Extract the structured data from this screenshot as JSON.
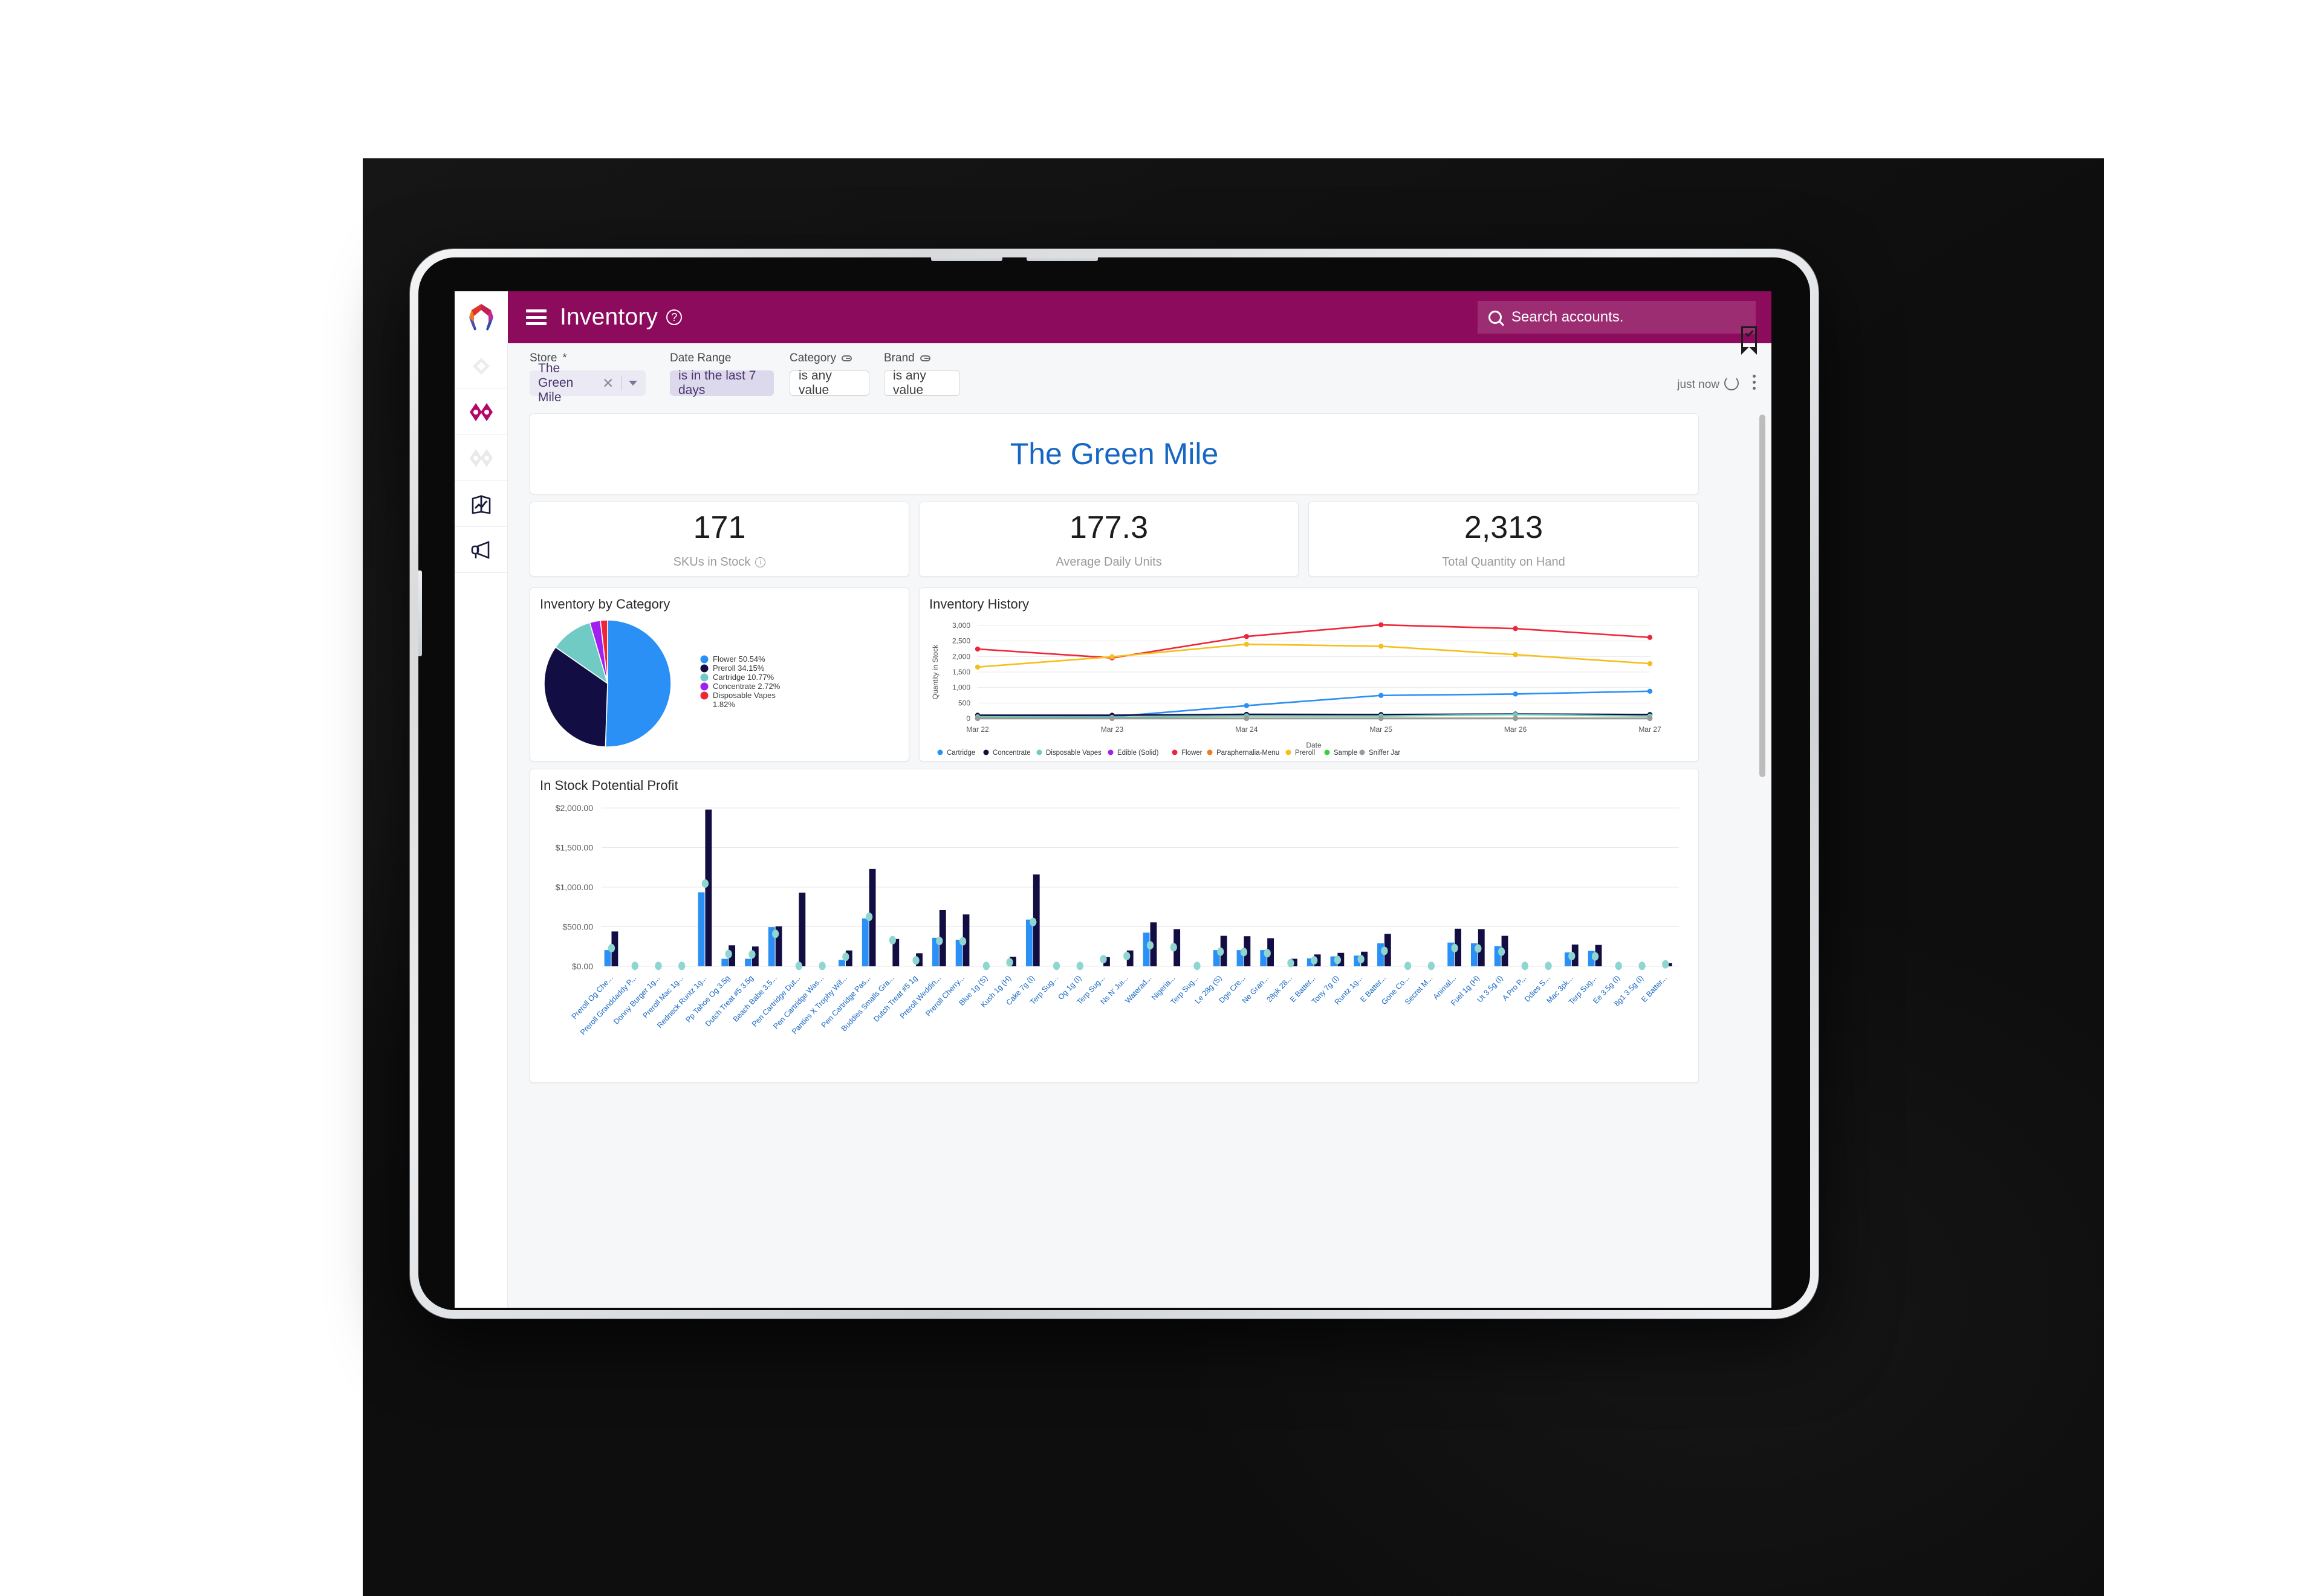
{
  "app": {
    "title": "Inventory",
    "help_icon": "question-mark-circle-icon",
    "menu_icon": "hamburger-menu-icon",
    "brand_color": "#8c0b5c"
  },
  "search": {
    "placeholder": "Search accounts.",
    "icon": "search-icon"
  },
  "sidebar": {
    "items": [
      {
        "name": "diamond-outline-icon",
        "active": false
      },
      {
        "name": "double-diamond-icon",
        "active": true
      },
      {
        "name": "double-diamond-light-icon",
        "active": false
      },
      {
        "name": "report-trend-icon",
        "active": false
      },
      {
        "name": "megaphone-icon",
        "active": false
      }
    ]
  },
  "filters": [
    {
      "label": "Store",
      "required": "*",
      "value": "The Green Mile",
      "style": "selected",
      "has_clear": true,
      "has_dropdown": true
    },
    {
      "label": "Date Range",
      "value": "is in the last 7 days",
      "style": "filled"
    },
    {
      "label": "Category",
      "value": "is any value",
      "style": "empty",
      "linked": true
    },
    {
      "label": "Brand",
      "value": "is any value",
      "style": "empty",
      "linked": true
    }
  ],
  "toolbar": {
    "updated_label": "just now",
    "refresh_icon": "refresh-icon",
    "more_icon": "kebab-menu-icon",
    "bookmark_icon": "bookmark-check-icon"
  },
  "dashboard": {
    "store_title": "The Green Mile",
    "kpis": [
      {
        "value": "171",
        "label": "SKUs in Stock",
        "has_info": true
      },
      {
        "value": "177.3",
        "label": "Average Daily Units",
        "has_info": false
      },
      {
        "value": "2,313",
        "label": "Total Quantity on Hand",
        "has_info": false
      }
    ],
    "cards": {
      "pie_title": "Inventory by Category",
      "line_title": "Inventory History",
      "bar_title": "In Stock Potential Profit"
    }
  },
  "chart_data": [
    {
      "type": "pie",
      "title": "Inventory by Category",
      "legend_position": "right",
      "categories": [
        "Flower",
        "Preroll",
        "Cartridge",
        "Concentrate",
        "Disposable Vapes"
      ],
      "values": [
        50.54,
        34.15,
        10.77,
        2.72,
        1.82
      ],
      "labels": [
        "Flower 50.54%",
        "Preroll 34.15%",
        "Cartridge 10.77%",
        "Concentrate 2.72%",
        "Disposable Vapes 1.82%"
      ],
      "colors": [
        "#2a90f5",
        "#120d42",
        "#6fcbc4",
        "#a020f0",
        "#ee2737"
      ]
    },
    {
      "type": "line",
      "title": "Inventory History",
      "xlabel": "Date",
      "ylabel": "Quantity in Stock",
      "x": [
        "Mar 22",
        "Mar 23",
        "Mar 24",
        "Mar 25",
        "Mar 26",
        "Mar 27"
      ],
      "ylim": [
        0,
        3000
      ],
      "yticks": [
        0,
        500,
        1000,
        1500,
        2000,
        2500,
        3000
      ],
      "ytick_labels": [
        "0",
        "500",
        "1,000",
        "1,500",
        "2,000",
        "2,500",
        "3,000"
      ],
      "grid": true,
      "legend_position": "bottom",
      "series": [
        {
          "name": "Cartridge",
          "color": "#2a90f5",
          "values": [
            95,
            60,
            415,
            745,
            790,
            880
          ]
        },
        {
          "name": "Concentrate",
          "color": "#120d42",
          "values": [
            105,
            105,
            135,
            128,
            145,
            128
          ]
        },
        {
          "name": "Disposable Vapes",
          "color": "#6fcbc4",
          "values": [
            55,
            40,
            85,
            82,
            130,
            78
          ]
        },
        {
          "name": "Edible (Solid)",
          "color": "#a020f0",
          "values": [
            5,
            5,
            5,
            5,
            5,
            5
          ]
        },
        {
          "name": "Flower",
          "color": "#ee2737",
          "values": [
            2240,
            1955,
            2645,
            3020,
            2900,
            2615
          ]
        },
        {
          "name": "Paraphernalia-Menu",
          "color": "#f07b1d",
          "values": [
            8,
            8,
            8,
            8,
            8,
            8
          ]
        },
        {
          "name": "Preroll",
          "color": "#f5bf1b",
          "values": [
            1660,
            1990,
            2395,
            2330,
            2060,
            1770
          ]
        },
        {
          "name": "Sample",
          "color": "#3ecf3e",
          "values": [
            3,
            3,
            3,
            3,
            3,
            3
          ]
        },
        {
          "name": "Sniffer Jar",
          "color": "#9a9a9a",
          "values": [
            2,
            2,
            2,
            2,
            2,
            2
          ]
        }
      ]
    },
    {
      "type": "bar",
      "title": "In Stock Potential Profit",
      "ylim": [
        0,
        2000
      ],
      "yticks": [
        0,
        500,
        1000,
        1500,
        2000
      ],
      "ytick_labels": [
        "$0.00",
        "$500.00",
        "$1,000.00",
        "$1,500.00",
        "$2,000.00"
      ],
      "grid": true,
      "series": [
        {
          "name": "bar-navy",
          "color": "#120d42"
        },
        {
          "name": "bar-blue",
          "color": "#2a90f5"
        },
        {
          "name": "dot-teal",
          "color": "#8fd6d0"
        }
      ],
      "categories": [
        "Preroll Og Che...",
        "Preroll Granddaddy P...",
        "Donny Burger 1g...",
        "Preroll Mac 1g...",
        "Redneck Runtz 1g...",
        "Pp Tahoe Og 3.5g",
        "Dutch Treat #5 3.5g",
        "Beach Babe 3.5...",
        "Pen Cartridge Dut...",
        "Pen Cartridge Was...",
        "Panties X Trophy Wif...",
        "Pen Cartridge Pas...",
        "Buddies Smalls Gra...",
        "Dutch Treat #5 1g",
        "Preroll Weddin...",
        "Preroll Cherry...",
        "Blue 1g (S)",
        "Kush 1g (H)",
        "Cake 7g (I)",
        "Terp Sug...",
        "Og 1g (I)",
        "Terp Sug...",
        "Ns N' Jui...",
        "Waterad...",
        "Nigeria...",
        "Terp Sug...",
        "Le 28g (S)",
        "Dge Cre...",
        "Ne Gran...",
        "28pk 28...",
        "E Batter...",
        "Tony 7g (I)",
        "Runtz 1g...",
        "E Batter...",
        "Gone Co...",
        "Secret M...",
        "Animal...",
        "Fuel 1g (H)",
        "Ut 3.5g (I)",
        "A Pro P...",
        "Ddies S...",
        "Mac 3pk...",
        "Terp Sug...",
        "Ee 3.5g (I)",
        "8g1 3.5g (I)",
        "E Batter..."
      ],
      "navy_values": [
        440,
        0,
        0,
        0,
        1980,
        265,
        250,
        505,
        930,
        0,
        200,
        1230,
        345,
        165,
        710,
        655,
        0,
        120,
        1160,
        0,
        0,
        115,
        200,
        555,
        470,
        0,
        385,
        380,
        355,
        95,
        150,
        170,
        185,
        410,
        0,
        0,
        475,
        470,
        385,
        0,
        0,
        275,
        270,
        0,
        0,
        40
      ],
      "blue_values": [
        205,
        0,
        0,
        0,
        935,
        95,
        95,
        495,
        0,
        0,
        80,
        605,
        0,
        0,
        360,
        335,
        0,
        0,
        590,
        0,
        0,
        0,
        0,
        425,
        0,
        0,
        205,
        205,
        205,
        0,
        100,
        125,
        135,
        290,
        0,
        0,
        300,
        290,
        255,
        0,
        0,
        175,
        195,
        0,
        0,
        0
      ],
      "teal_values": [
        230,
        5,
        5,
        5,
        1045,
        155,
        150,
        410,
        5,
        5,
        120,
        625,
        330,
        75,
        320,
        315,
        5,
        50,
        560,
        5,
        5,
        90,
        130,
        265,
        240,
        5,
        185,
        180,
        165,
        40,
        75,
        80,
        90,
        195,
        5,
        5,
        230,
        225,
        185,
        5,
        5,
        130,
        125,
        5,
        5,
        25
      ]
    }
  ]
}
